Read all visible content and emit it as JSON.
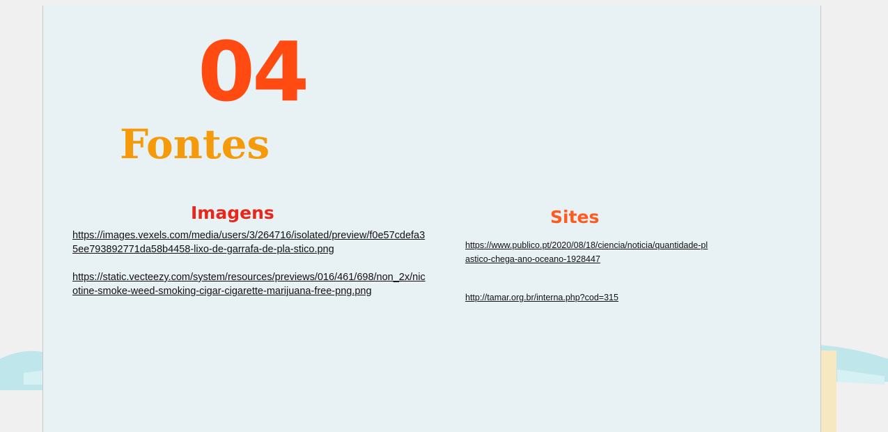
{
  "slide": {
    "number": "04",
    "title": "Fontes",
    "colors": {
      "number": "#ff4a12",
      "title": "#f59a0a",
      "sky": "#e8f1f4",
      "sand": "#f6e8c0",
      "water": "#9fd6dc",
      "sun": "#f5dca0"
    }
  },
  "images_section": {
    "heading": "Imagens",
    "links": [
      "https://images.vexels.com/media/users/3/264716/isolated/preview/f0e57cdefa35ee793892771da58b4458-lixo-de-garrafa-de-pla-stico.png",
      "https://static.vecteezy.com/system/resources/previews/016/461/698/non_2x/nicotine-smoke-weed-smoking-cigar-cigarette-marijuana-free-png.png"
    ]
  },
  "sites_section": {
    "heading": "Sites",
    "links": [
      "https://www.publico.pt/2020/08/18/ciencia/noticia/quantidade-plastico-chega-ano-oceano-1928447",
      "http://tamar.org.br/interna.php?cod=315"
    ]
  },
  "illustration": {
    "icons": [
      "cloud-icon",
      "sun-icon",
      "plant-icon",
      "bottle-icon",
      "seaweed-icon",
      "woman-figure",
      "man-figure",
      "recycle-bag-icon",
      "broom-icon"
    ]
  }
}
